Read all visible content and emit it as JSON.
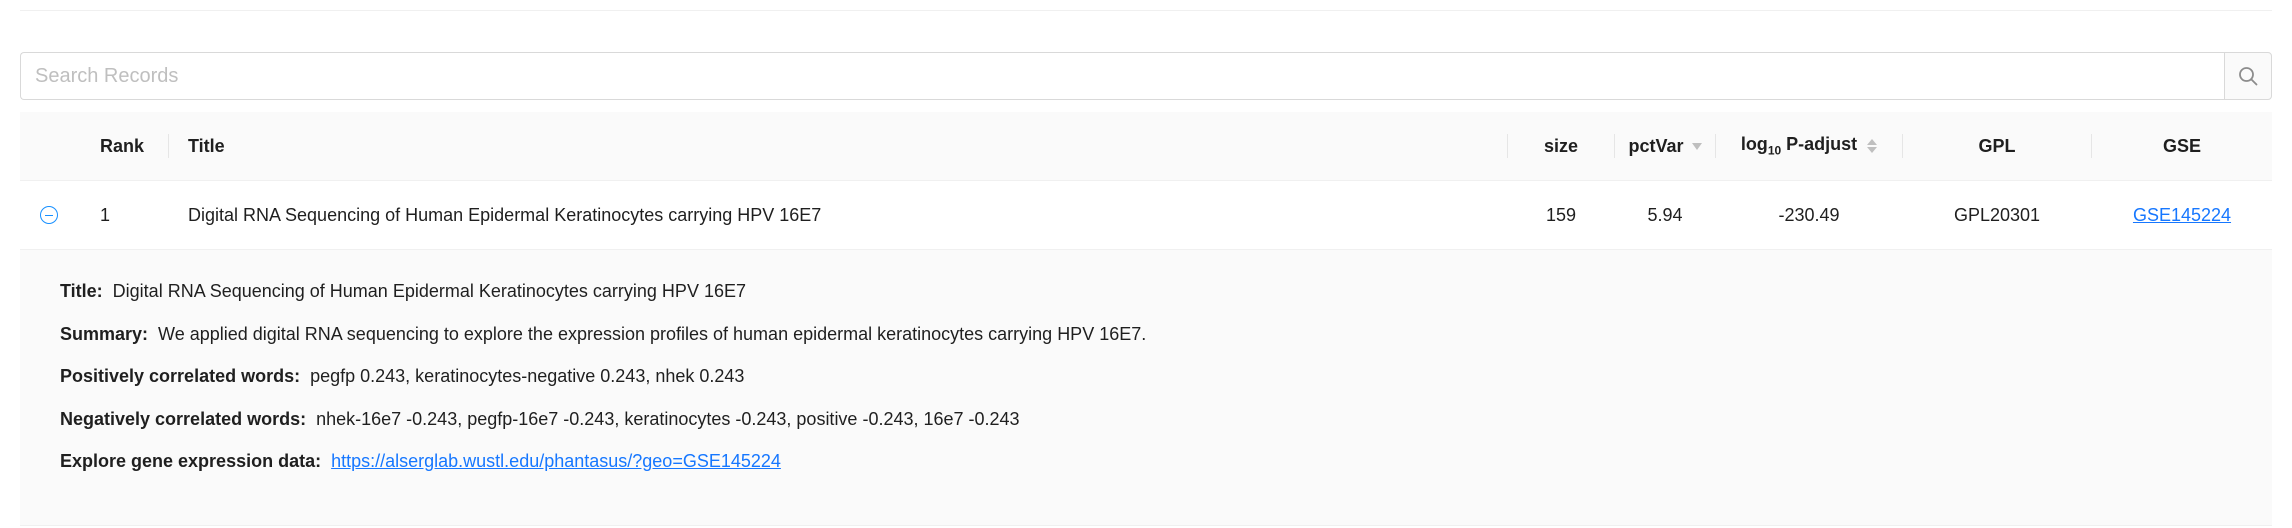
{
  "search": {
    "placeholder": "Search Records"
  },
  "table": {
    "headers": {
      "rank": "Rank",
      "title": "Title",
      "size": "size",
      "pctvar": "pctVar",
      "padj_prefix": "log",
      "padj_sub": "10",
      "padj_suffix": " P-adjust",
      "gpl": "GPL",
      "gse": "GSE"
    },
    "rows": [
      {
        "rank": "1",
        "title": "Digital RNA Sequencing of Human Epidermal Keratinocytes carrying HPV 16E7",
        "size": "159",
        "pctvar": "5.94",
        "padj": "-230.49",
        "gpl": "GPL20301",
        "gse": "GSE145224"
      }
    ]
  },
  "details": {
    "title_label": "Title:",
    "title_value": "Digital RNA Sequencing of Human Epidermal Keratinocytes carrying HPV 16E7",
    "summary_label": "Summary:",
    "summary_value": "We applied digital RNA sequencing to explore the expression profiles of human epidermal keratinocytes carrying HPV 16E7.",
    "pos_label": "Positively correlated words:",
    "pos_value": "pegfp 0.243, keratinocytes-negative 0.243, nhek 0.243",
    "neg_label": "Negatively correlated words:",
    "neg_value": "nhek-16e7 -0.243, pegfp-16e7 -0.243, keratinocytes -0.243, positive -0.243, 16e7 -0.243",
    "explore_label": "Explore gene expression data:",
    "explore_url": "https://alserglab.wustl.edu/phantasus/?geo=GSE145224"
  },
  "icons": {
    "search": "search-icon",
    "expand": "collapse-row-icon",
    "sort": "sort-icon",
    "filter": "filter-icon"
  },
  "colors": {
    "link": "#1677ff",
    "header_bg": "#fafafa",
    "expand_accent": "#1890ff"
  }
}
